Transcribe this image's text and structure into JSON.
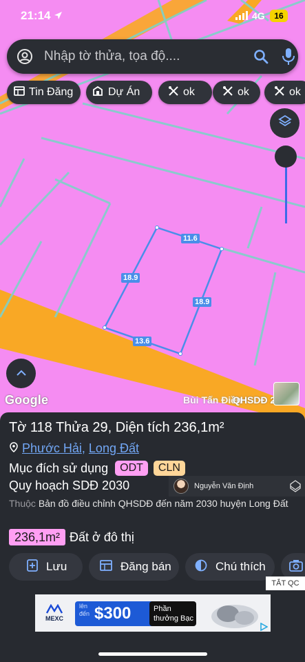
{
  "status": {
    "time": "21:14",
    "network": "4G",
    "battery": "16"
  },
  "search": {
    "placeholder": "Nhập tờ thửa, tọa độ...."
  },
  "chips": [
    {
      "label": "Tin Đăng",
      "icon": "listing-icon"
    },
    {
      "label": "Dự Án",
      "icon": "building-icon"
    },
    {
      "label": "ok",
      "icon": "tools-icon"
    },
    {
      "label": "ok",
      "icon": "tools-icon"
    },
    {
      "label": "ok",
      "icon": "tools-icon"
    }
  ],
  "map": {
    "google_label": "Google",
    "street_label": "Bùi Tấn Điền",
    "layer_label": "QHSDĐ 2030",
    "dimensions": {
      "top": "11.6",
      "left": "18.9",
      "right": "18.9",
      "bottom": "13.6"
    },
    "colors": {
      "land": "#f58cf2",
      "road": "#f9a825",
      "edge": "#7fd1c8",
      "parcel": "#4a8ee9"
    }
  },
  "parcel": {
    "title": "Tờ 118 Thửa 29, Diện tích 236,1m²",
    "ward": "Phước Hải",
    "district": "Long Đất",
    "separator": ",",
    "purpose_label": "Mục đích sử dụng",
    "purpose_codes": [
      "ODT",
      "CLN"
    ],
    "plan_label": "Quy hoạch SDĐ 2030",
    "belongs_prefix": "Thuộc",
    "belongs_text": "Bản đồ điều chỉnh QHSDĐ đến năm 2030 huyện Long Đất",
    "area_value": "236,1m²",
    "area_type": "Đất ở đô thị"
  },
  "overlay": {
    "name": "Nguyễn Văn Định"
  },
  "actions": [
    {
      "label": "Lưu",
      "icon": "save-icon"
    },
    {
      "label": "Đăng bán",
      "icon": "post-sale-icon"
    },
    {
      "label": "Chú thích",
      "icon": "legend-icon"
    }
  ],
  "ad": {
    "close_label": "TẮT QC",
    "brand": "MEXC",
    "small": "lên đến",
    "amount": "$300",
    "reward": "Phần thưởng Bạc"
  }
}
